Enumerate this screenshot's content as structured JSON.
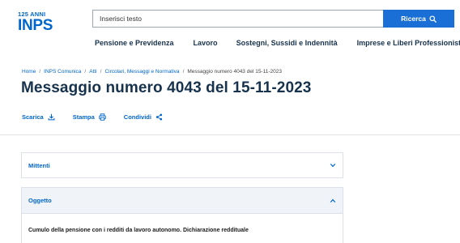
{
  "logo": {
    "anniversary": "125 ANNI",
    "brand": "INPS"
  },
  "search": {
    "value": "Inserisci testo",
    "button_label": "Ricerca"
  },
  "nav": [
    "Pensione e Previdenza",
    "Lavoro",
    "Sostegni, Sussidi e Indennità",
    "Imprese e Liberi Professionisti"
  ],
  "breadcrumb": {
    "items": [
      "Home",
      "INPS Comunica",
      "Atti",
      "Circolari, Messaggi e Normativa"
    ],
    "current": "Messaggio numero 4043 del 15-11-2023"
  },
  "title": "Messaggio numero 4043 del 15-11-2023",
  "actions": {
    "download": "Scarica",
    "print": "Stampa",
    "share": "Condividi"
  },
  "accordions": {
    "mittenti": {
      "label": "Mittenti",
      "expanded": false
    },
    "oggetto": {
      "label": "Oggetto",
      "expanded": true,
      "content": "Cumulo della pensione con i redditi da lavoro autonomo. Dichiarazione reddituale"
    }
  },
  "colors": {
    "accent": "#0066cc",
    "button": "#1a6fd6",
    "title": "#17324d"
  },
  "icons": [
    "search-icon",
    "download-icon",
    "print-icon",
    "share-icon",
    "chevron-down-icon",
    "chevron-up-icon"
  ]
}
